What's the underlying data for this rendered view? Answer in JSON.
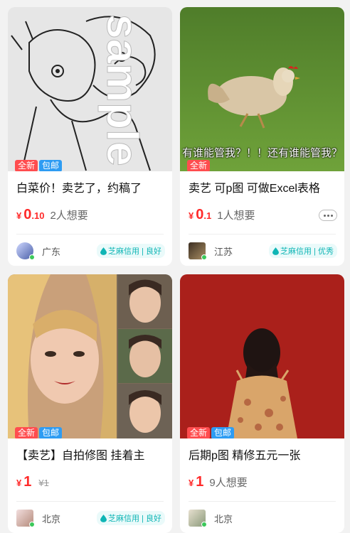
{
  "colors": {
    "accent_red": "#ff2a2a",
    "tag_new": "#ff4d4f",
    "tag_ship": "#2e9cf3",
    "credit_teal": "#0fb5b5"
  },
  "cards": [
    {
      "tags": [
        "全新",
        "包邮"
      ],
      "title": "白菜价！卖艺了，约稿了",
      "price_symbol": "¥",
      "price_int": "0",
      "price_dec": ".10",
      "want": "2人想要",
      "seller_location": "广东",
      "credit": "芝麻信用 | 良好",
      "image_icon": "manga-drawing"
    },
    {
      "tags": [
        "全新"
      ],
      "title": "卖艺 可p图 可做Excel表格",
      "price_symbol": "¥",
      "price_int": "0",
      "price_dec": ".1",
      "want": "1人想要",
      "seller_location": "江苏",
      "credit": "芝麻信用 | 优秀",
      "image_caption": "有谁能管我？！！还有谁能管我？",
      "image_icon": "running-chicken"
    },
    {
      "tags": [
        "全新",
        "包邮"
      ],
      "title": "【卖艺】自拍修图 挂着主",
      "price_symbol": "¥",
      "price_int": "1",
      "price_orig": "¥1",
      "seller_location": "北京",
      "credit": "芝麻信用 | 良好",
      "image_icon": "selfie-collage"
    },
    {
      "tags": [
        "全新",
        "包邮"
      ],
      "title": "后期p图 精修五元一张",
      "price_symbol": "¥",
      "price_int": "1",
      "want": "9人想要",
      "seller_location": "北京",
      "image_icon": "red-backdrop-portrait"
    }
  ]
}
